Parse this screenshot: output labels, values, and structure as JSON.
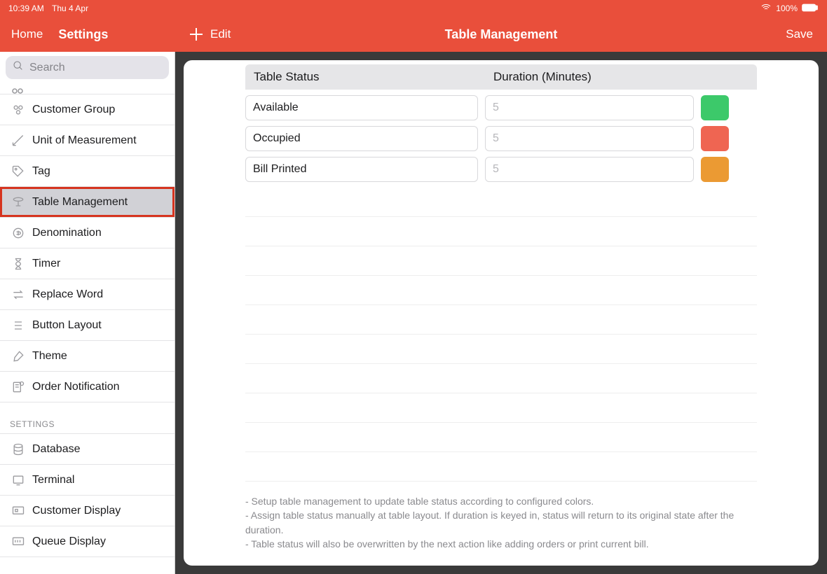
{
  "status_bar": {
    "time": "10:39 AM",
    "date": "Thu 4 Apr",
    "battery": "100%"
  },
  "header": {
    "home_label": "Home",
    "settings_label": "Settings",
    "edit_label": "Edit",
    "page_title": "Table Management",
    "save_label": "Save"
  },
  "search": {
    "placeholder": "Search"
  },
  "sidebar": {
    "items": [
      {
        "label": "Customer Group"
      },
      {
        "label": "Unit of Measurement"
      },
      {
        "label": "Tag"
      },
      {
        "label": "Table Management"
      },
      {
        "label": "Denomination"
      },
      {
        "label": "Timer"
      },
      {
        "label": "Replace Word"
      },
      {
        "label": "Button Layout"
      },
      {
        "label": "Theme"
      },
      {
        "label": "Order Notification"
      }
    ],
    "section_label": "SETTINGS",
    "settings_items": [
      {
        "label": "Database"
      },
      {
        "label": "Terminal"
      },
      {
        "label": "Customer Display"
      },
      {
        "label": "Queue Display"
      }
    ]
  },
  "table": {
    "columns": {
      "status": "Table Status",
      "duration": "Duration (Minutes)"
    },
    "rows": [
      {
        "status": "Available",
        "duration_placeholder": "5",
        "color": "#3cc96a"
      },
      {
        "status": "Occupied",
        "duration_placeholder": "5",
        "color": "#ef6552"
      },
      {
        "status": "Bill Printed",
        "duration_placeholder": "5",
        "color": "#eb9a33"
      }
    ]
  },
  "help": {
    "line1": "- Setup table management to update table status according to configured colors.",
    "line2": "- Assign table status manually at table layout. If duration is keyed in, status will return to its original state after the duration.",
    "line3": "- Table status will also be overwritten by the next action like adding orders or print current bill."
  }
}
